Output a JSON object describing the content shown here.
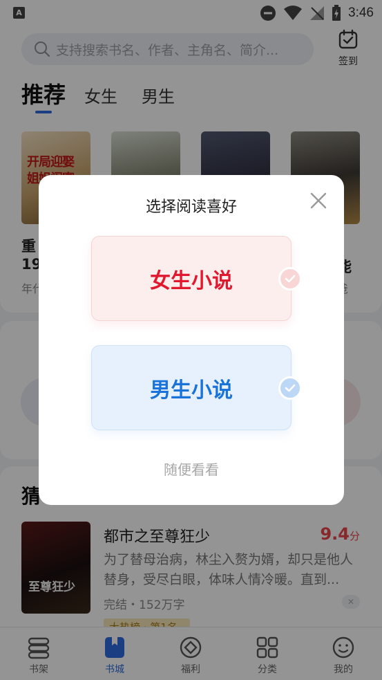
{
  "status_bar": {
    "time": "3:46",
    "icons": [
      "app-notification-icon",
      "do-not-disturb-icon",
      "wifi-icon",
      "no-signal-icon",
      "battery-charging-icon"
    ]
  },
  "header": {
    "search_placeholder": "支持搜索书名、作者、主角名、简介...",
    "checkin_label": "签到"
  },
  "tabs": [
    {
      "label": "推荐",
      "active": true
    },
    {
      "label": "女生",
      "active": false
    },
    {
      "label": "男生",
      "active": false
    }
  ],
  "recommend": {
    "title_fragments": [
      "重",
      "19",
      "能"
    ],
    "sub_fragments": [
      "年代",
      "爸"
    ]
  },
  "guess": {
    "heading": "猜",
    "book": {
      "title": "都市之至尊狂少",
      "score": "9.4",
      "score_unit": "分",
      "description": "为了替母治病，林尘入赘为婿，却只是他人替身，受尽白眼，体味人情冷暖。直到...",
      "meta": "完结・152万字",
      "rank_tag": "大热榜 · 第1名"
    }
  },
  "bottom_nav": [
    {
      "label": "书架",
      "icon": "bookshelf-icon",
      "active": false
    },
    {
      "label": "书城",
      "icon": "bookstore-icon",
      "active": true
    },
    {
      "label": "福利",
      "icon": "welfare-icon",
      "active": false
    },
    {
      "label": "分类",
      "icon": "category-icon",
      "active": false
    },
    {
      "label": "我的",
      "icon": "profile-icon",
      "active": false
    }
  ],
  "dialog": {
    "title": "选择阅读喜好",
    "female_label": "女生小说",
    "male_label": "男生小说",
    "skip_label": "随便看看"
  },
  "colors": {
    "accent_blue": "#2d6cdf",
    "female_red": "#e0192e",
    "male_blue": "#1a73d8",
    "score_red": "#e8454a"
  }
}
